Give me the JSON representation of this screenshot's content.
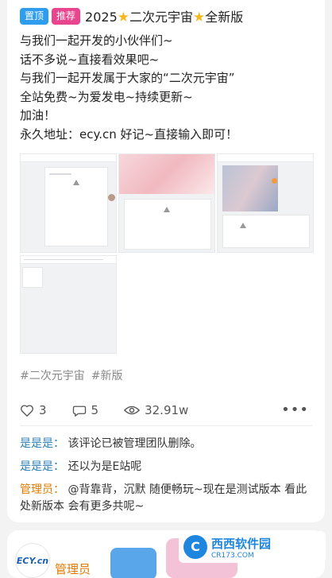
{
  "post": {
    "badges": {
      "top": "置顶",
      "recommend": "推荐"
    },
    "title_prefix": "2025",
    "title_mid": "二次元宇宙",
    "title_suffix": "全新版",
    "lines": [
      "与我们一起开发的小伙伴们~",
      "话不多说~直接看效果吧~",
      "与我们一起开发属于大家的“二次元宇宙”",
      "全站免费~为爱发电~持续更新~",
      "加油！",
      "永久地址：ecy.cn 好记~直接输入即可！"
    ],
    "tags": [
      "#二次元宇宙",
      "#新版"
    ],
    "stats": {
      "likes": "3",
      "comments": "5",
      "views": "32.91w"
    }
  },
  "comments": [
    {
      "name": "是是是：",
      "text": "该评论已被管理团队删除。"
    },
    {
      "name": "是是是：",
      "text": "还以为是E站呢"
    },
    {
      "name": "管理员：",
      "text": "@背靠背，沉默 随便畅玩~现在是测试版本 看此处新版本 会有更多共呢~"
    }
  ],
  "next_card": {
    "logo": "ECY.cn",
    "author": "管理员"
  },
  "watermark": {
    "brand": "西西软件园",
    "domain": "CR173.COM"
  },
  "colors": {
    "badge_top": "#2f9dee",
    "badge_recommend": "#e9448e",
    "commenter": "#2d7fb8",
    "admin": "#e07a00"
  }
}
